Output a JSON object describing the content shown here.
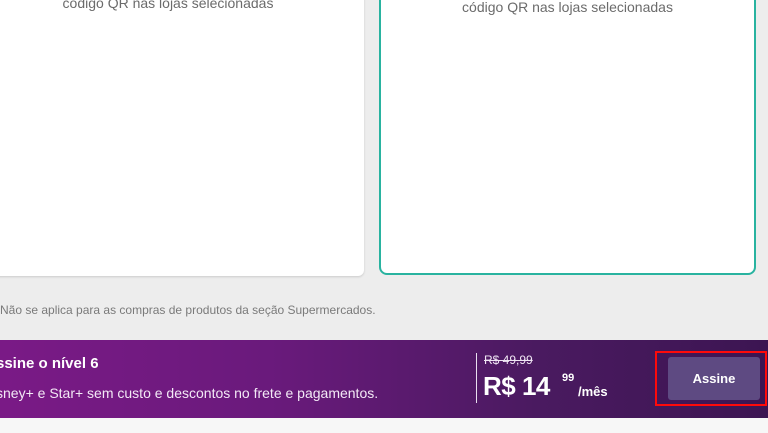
{
  "cards": {
    "left": {
      "description": "código QR nas lojas selecionadas"
    },
    "right": {
      "description": "código QR nas lojas selecionadas"
    }
  },
  "note": "Não se aplica para as compras de produtos da seção Supermercados.",
  "banner": {
    "title": "ssine o nível 6",
    "subtitle": "sney+ e Star+ sem custo e descontos no frete e pagamentos.",
    "old_price": "R$ 49,99",
    "price_main": "R$ 14",
    "price_cents": "99",
    "price_period": "/mês",
    "subscribe_label": "Assine"
  },
  "colors": {
    "selected_border": "#29b3a0",
    "banner_start": "#7a1a86",
    "banner_end": "#3c1552",
    "button": "#5e4a82",
    "highlight": "#ff0a0a"
  }
}
